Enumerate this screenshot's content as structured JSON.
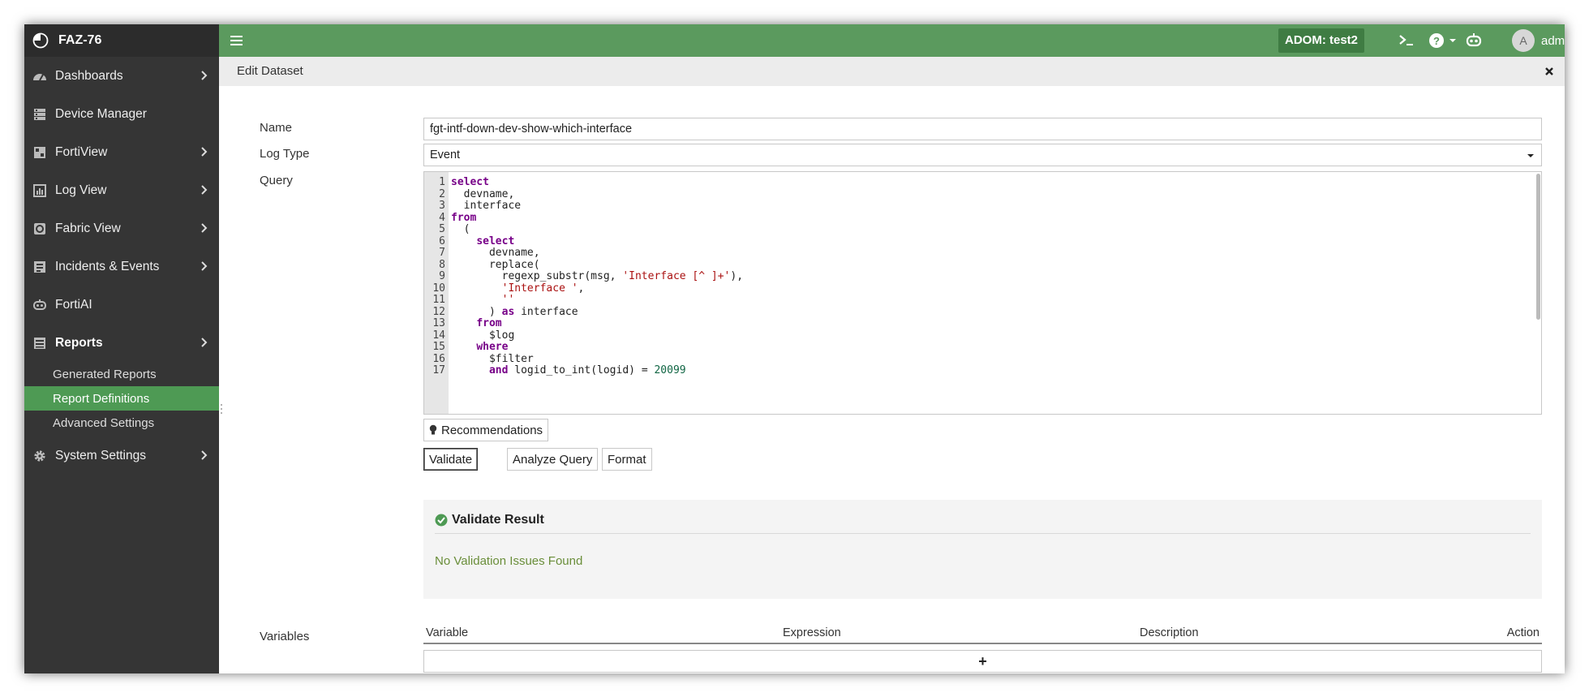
{
  "app": {
    "brand": "FAZ-76",
    "adom": "ADOM: test2",
    "user": "admin",
    "avatar_letter": "A"
  },
  "sidebar": {
    "items": [
      {
        "label": "Dashboards",
        "icon": "dashboard-icon"
      },
      {
        "label": "Device Manager",
        "icon": "device-manager-icon"
      },
      {
        "label": "FortiView",
        "icon": "fortiview-icon"
      },
      {
        "label": "Log View",
        "icon": "log-view-icon"
      },
      {
        "label": "Fabric View",
        "icon": "fabric-view-icon"
      },
      {
        "label": "Incidents & Events",
        "icon": "incidents-icon"
      },
      {
        "label": "FortiAI",
        "icon": "fortiai-icon"
      },
      {
        "label": "Reports",
        "icon": "reports-icon"
      },
      {
        "label": "System Settings",
        "icon": "gear-icon"
      }
    ],
    "reports_sub": [
      "Generated Reports",
      "Report Definitions",
      "Advanced Settings"
    ],
    "active_sub": "Report Definitions"
  },
  "page": {
    "title": "Edit Dataset"
  },
  "form": {
    "name_label": "Name",
    "name_value": "fgt-intf-down-dev-show-which-interface",
    "logtype_label": "Log Type",
    "logtype_value": "Event",
    "query_label": "Query",
    "variables_label": "Variables"
  },
  "query_lines": [
    "select",
    "  devname,",
    "  interface",
    "from",
    "  (",
    "    select",
    "      devname,",
    "      replace(",
    "        regexp_substr(msg, 'Interface [^ ]+'),",
    "        'Interface ',",
    "        ''",
    "      ) as interface",
    "    from",
    "      $log",
    "    where",
    "      $filter",
    "      and logid_to_int(logid) = 20099"
  ],
  "buttons": {
    "recommendations": "Recommendations",
    "validate": "Validate",
    "analyze": "Analyze Query",
    "format": "Format"
  },
  "validate_result": {
    "title": "Validate Result",
    "message": "No Validation Issues Found"
  },
  "variables_table": {
    "columns": [
      "Variable",
      "Expression",
      "Description",
      "Action"
    ],
    "add_symbol": "+"
  },
  "colors": {
    "topbar": "#5b9a5e",
    "sidebar": "#353535",
    "active": "#4e9a54",
    "keyword": "#770088",
    "string": "#aa1111",
    "success": "#6a8e3a"
  }
}
